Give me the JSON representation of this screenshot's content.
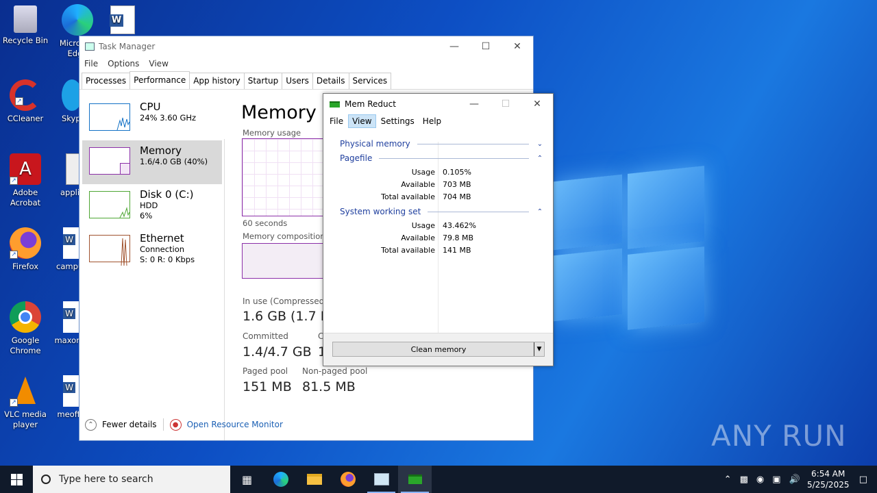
{
  "desktop": {
    "icons": [
      {
        "label": "Recycle Bin"
      },
      {
        "label": "Microsoft Edge"
      },
      {
        "label": "CCleaner"
      },
      {
        "label": "Skype"
      },
      {
        "label": "Adobe Acrobat"
      },
      {
        "label": "applied"
      },
      {
        "label": "Firefox"
      },
      {
        "label": "campu"
      },
      {
        "label": "Google Chrome"
      },
      {
        "label": "maxon"
      },
      {
        "label": "VLC media player"
      },
      {
        "label": "meoff"
      }
    ],
    "watermark": "ANY RUN"
  },
  "task_manager": {
    "title": "Task Manager",
    "menu": [
      "File",
      "Options",
      "View"
    ],
    "tabs": [
      "Processes",
      "Performance",
      "App history",
      "Startup",
      "Users",
      "Details",
      "Services"
    ],
    "active_tab": "Performance",
    "perf_items": [
      {
        "name": "CPU",
        "line1": "24%  3.60 GHz",
        "line2": ""
      },
      {
        "name": "Memory",
        "line1": "1.6/4.0 GB (40%)",
        "line2": ""
      },
      {
        "name": "Disk 0 (C:)",
        "line1": "HDD",
        "line2": "6%"
      },
      {
        "name": "Ethernet",
        "line1": "Connection",
        "line2": "S: 0  R: 0 Kbps"
      }
    ],
    "heading": "Memory",
    "memory_usage_label": "Memory usage",
    "seconds_label": "60 seconds",
    "composition_label": "Memory composition",
    "stats": {
      "in_use_label": "In use (Compressed)",
      "in_use_value": "1.6 GB (1.7 M",
      "committed_label": "Committed",
      "committed_value": "1.4/4.7 GB",
      "cached_label_partial": "C",
      "cached_value_partial": "1",
      "paged_label": "Paged pool",
      "paged_value": "151 MB",
      "nonpaged_label": "Non-paged pool",
      "nonpaged_value": "81.5 MB"
    },
    "footer": {
      "fewer_details": "Fewer details",
      "resource_monitor": "Open Resource Monitor"
    }
  },
  "mem_reduct": {
    "title": "Mem Reduct",
    "menu": [
      "File",
      "View",
      "Settings",
      "Help"
    ],
    "groups": {
      "physical": "Physical memory",
      "pagefile": "Pagefile",
      "working_set": "System working set"
    },
    "pagefile_rows": [
      {
        "key": "Usage",
        "value": "0.105%"
      },
      {
        "key": "Available",
        "value": "703 MB"
      },
      {
        "key": "Total available",
        "value": "704 MB"
      }
    ],
    "working_set_rows": [
      {
        "key": "Usage",
        "value": "43.462%"
      },
      {
        "key": "Available",
        "value": "79.8 MB"
      },
      {
        "key": "Total available",
        "value": "141 MB"
      }
    ],
    "clean_button": "Clean memory"
  },
  "taskbar": {
    "search_placeholder": "Type here to search",
    "time": "6:54 AM",
    "date": "5/25/2025"
  }
}
